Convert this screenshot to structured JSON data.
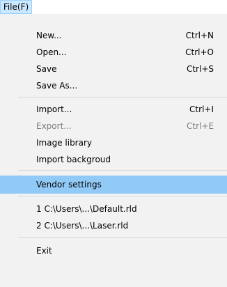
{
  "menubar": {
    "file_label": "File(F)"
  },
  "menu": {
    "items": [
      {
        "label": "New...",
        "shortcut": "Ctrl+N"
      },
      {
        "label": "Open...",
        "shortcut": "Ctrl+O"
      },
      {
        "label": "Save",
        "shortcut": "Ctrl+S"
      },
      {
        "label": "Save As...",
        "shortcut": ""
      },
      {
        "label": "Import...",
        "shortcut": "Ctrl+I"
      },
      {
        "label": "Export...",
        "shortcut": "Ctrl+E",
        "disabled": true
      },
      {
        "label": "Image library",
        "shortcut": ""
      },
      {
        "label": "Import backgroud",
        "shortcut": ""
      },
      {
        "label": "Vendor settings",
        "shortcut": "",
        "highlighted": true
      },
      {
        "label": "1 C:\\Users\\...\\Default.rld",
        "shortcut": ""
      },
      {
        "label": "2 C:\\Users\\...\\Laser.rld",
        "shortcut": ""
      },
      {
        "label": "Exit",
        "shortcut": ""
      }
    ]
  },
  "colors": {
    "highlight": "#91c9f7",
    "menu_background": "#f2f2f2",
    "menubar_active": "#cce8ff",
    "disabled_text": "#7d7d7d"
  }
}
